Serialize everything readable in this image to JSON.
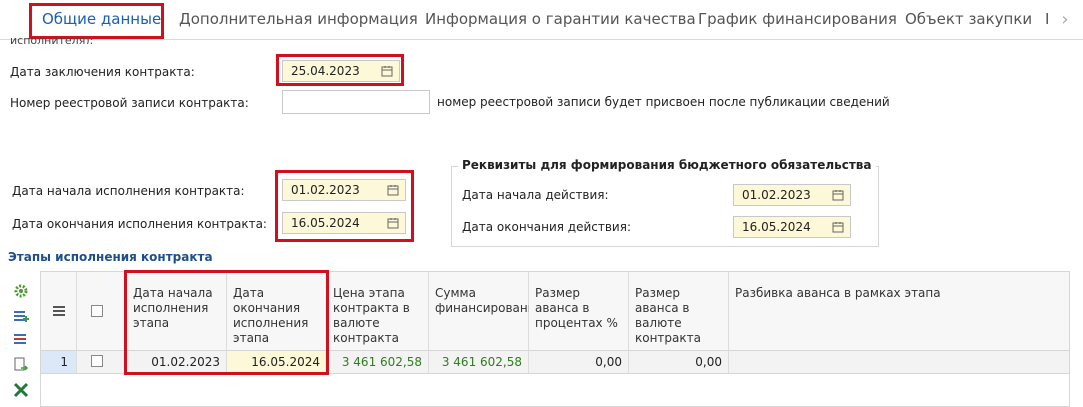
{
  "tabs": [
    {
      "label": "Общие данные"
    },
    {
      "label": "Дополнительная информация"
    },
    {
      "label": "Информация о гарантии качества"
    },
    {
      "label": "График финансирования"
    },
    {
      "label": "Объект закупки"
    },
    {
      "label": "I"
    }
  ],
  "form": {
    "truncated_text": "исполнителя):",
    "contract_date_label": "Дата заключения контракта:",
    "contract_date_value": "25.04.2023",
    "registry_label": "Номер реестровой записи контракта:",
    "registry_note": "номер реестровой записи будет присвоен после публикации сведений",
    "start_label": "Дата начала исполнения контракта:",
    "start_value": "01.02.2023",
    "end_label": "Дата окончания исполнения контракта:",
    "end_value": "16.05.2024"
  },
  "budget": {
    "title": "Реквизиты для формирования бюджетного обязательства",
    "start_label": "Дата начала действия:",
    "start_value": "01.02.2023",
    "end_label": "Дата окончания действия:",
    "end_value": "16.05.2024"
  },
  "stages": {
    "title": "Этапы исполнения контракта",
    "columns": [
      "Дата начала исполнения этапа",
      "Дата окончания исполнения этапа",
      "Цена этапа контракта в валюте контракта",
      "Сумма финансирования",
      "Размер аванса в процентах %",
      "Размер аванса в валюте контракта",
      "Разбивка аванса в рамках этапа"
    ],
    "row": {
      "num": "1",
      "start": "01.02.2023",
      "end": "16.05.2024",
      "price": "3 461 602,58",
      "financing": "3 461 602,58",
      "advance_pct": "0,00",
      "advance_sum": "0,00"
    }
  }
}
